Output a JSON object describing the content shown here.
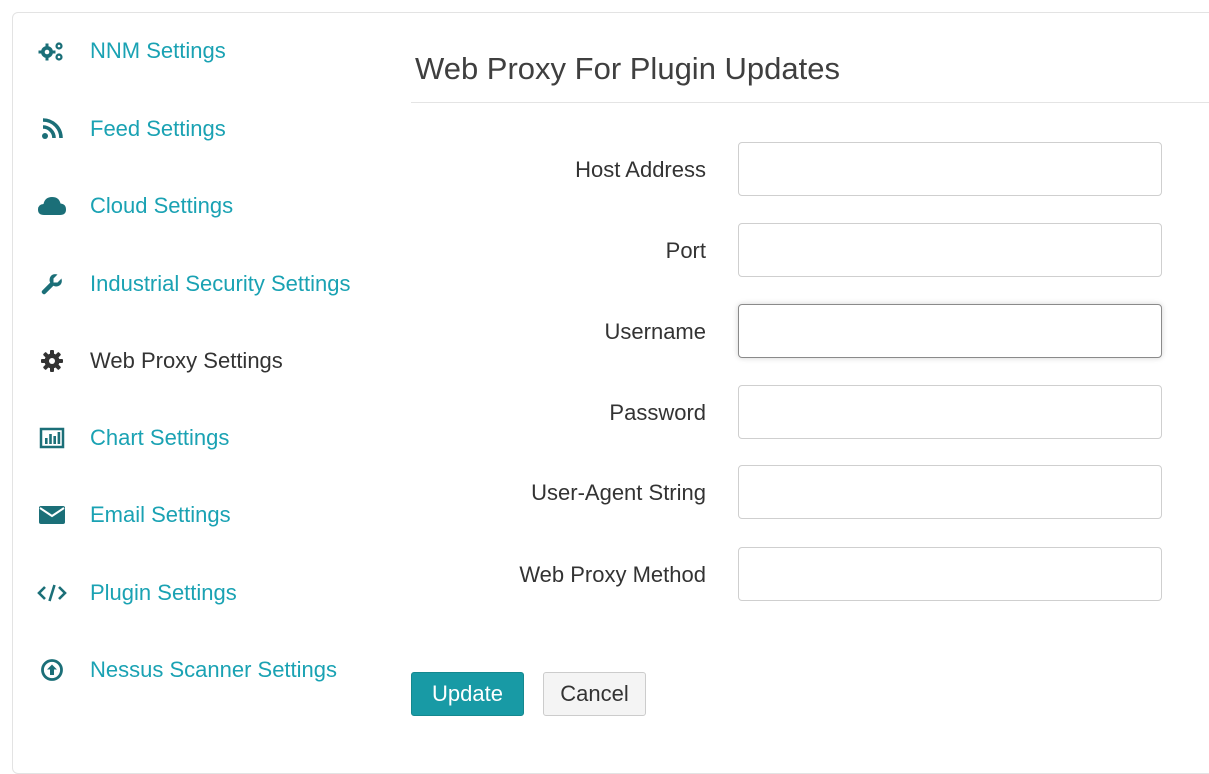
{
  "sidebar": {
    "items": [
      {
        "label": "NNM Settings",
        "icon": "gears-icon",
        "active": false
      },
      {
        "label": "Feed Settings",
        "icon": "rss-icon",
        "active": false
      },
      {
        "label": "Cloud Settings",
        "icon": "cloud-icon",
        "active": false
      },
      {
        "label": "Industrial Security Settings",
        "icon": "wrench-icon",
        "active": false
      },
      {
        "label": "Web Proxy Settings",
        "icon": "gear-icon",
        "active": true
      },
      {
        "label": "Chart Settings",
        "icon": "bar-chart-icon",
        "active": false
      },
      {
        "label": "Email Settings",
        "icon": "envelope-icon",
        "active": false
      },
      {
        "label": "Plugin Settings",
        "icon": "code-icon",
        "active": false
      },
      {
        "label": "Nessus Scanner Settings",
        "icon": "arrow-circle-up-icon",
        "active": false
      }
    ]
  },
  "main": {
    "title": "Web Proxy For Plugin Updates",
    "fields": [
      {
        "label": "Host Address",
        "value": "",
        "placeholder": ""
      },
      {
        "label": "Port",
        "value": "",
        "placeholder": ""
      },
      {
        "label": "Username",
        "value": "",
        "placeholder": "",
        "focused": true
      },
      {
        "label": "Password",
        "value": "",
        "placeholder": ""
      },
      {
        "label": "User-Agent String",
        "value": "",
        "placeholder": ""
      },
      {
        "label": "Web Proxy Method",
        "value": "",
        "placeholder": ""
      }
    ],
    "buttons": {
      "update_label": "Update",
      "cancel_label": "Cancel"
    }
  },
  "colors": {
    "accent": "#1aa2b3",
    "primary_button": "#189aa5",
    "active_text": "#333333"
  }
}
